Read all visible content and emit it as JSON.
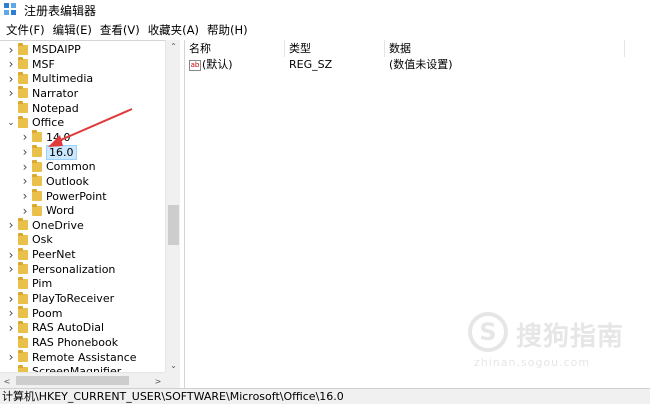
{
  "window": {
    "title": "注册表编辑器"
  },
  "menu": [
    "文件(F)",
    "编辑(E)",
    "查看(V)",
    "收藏夹(A)",
    "帮助(H)"
  ],
  "tree": {
    "items": [
      {
        "label": "MSDAIPP",
        "expandable": true,
        "level": 1
      },
      {
        "label": "MSF",
        "expandable": true,
        "level": 1
      },
      {
        "label": "Multimedia",
        "expandable": true,
        "level": 1
      },
      {
        "label": "Narrator",
        "expandable": true,
        "level": 1
      },
      {
        "label": "Notepad",
        "expandable": false,
        "level": 1
      },
      {
        "label": "Office",
        "expandable": true,
        "expanded": true,
        "level": 1
      },
      {
        "label": "14.0",
        "expandable": true,
        "level": 2
      },
      {
        "label": "16.0",
        "expandable": true,
        "level": 2,
        "selected": true
      },
      {
        "label": "Common",
        "expandable": true,
        "level": 2
      },
      {
        "label": "Outlook",
        "expandable": true,
        "level": 2
      },
      {
        "label": "PowerPoint",
        "expandable": true,
        "level": 2
      },
      {
        "label": "Word",
        "expandable": true,
        "level": 2
      },
      {
        "label": "OneDrive",
        "expandable": true,
        "level": 1
      },
      {
        "label": "Osk",
        "expandable": false,
        "level": 1
      },
      {
        "label": "PeerNet",
        "expandable": true,
        "level": 1
      },
      {
        "label": "Personalization",
        "expandable": true,
        "level": 1
      },
      {
        "label": "Pim",
        "expandable": false,
        "level": 1
      },
      {
        "label": "PlayToReceiver",
        "expandable": true,
        "level": 1
      },
      {
        "label": "Poom",
        "expandable": true,
        "level": 1
      },
      {
        "label": "RAS AutoDial",
        "expandable": true,
        "level": 1
      },
      {
        "label": "RAS Phonebook",
        "expandable": false,
        "level": 1
      },
      {
        "label": "Remote Assistance",
        "expandable": true,
        "level": 1
      },
      {
        "label": "ScreenMagnifier",
        "expandable": false,
        "level": 1
      }
    ]
  },
  "list": {
    "columns": [
      "名称",
      "类型",
      "数据"
    ],
    "rows": [
      {
        "icon": "ab",
        "name": "(默认)",
        "type": "REG_SZ",
        "data": "(数值未设置)"
      }
    ]
  },
  "status": {
    "path": "计算机\\HKEY_CURRENT_USER\\SOFTWARE\\Microsoft\\Office\\16.0"
  },
  "watermark": {
    "cn": "搜狗指南",
    "en": "zhinan.sogou.com"
  },
  "colors": {
    "accent": "#e03a3a",
    "folder": "#e8c04a",
    "selection": "#cce8ff"
  }
}
